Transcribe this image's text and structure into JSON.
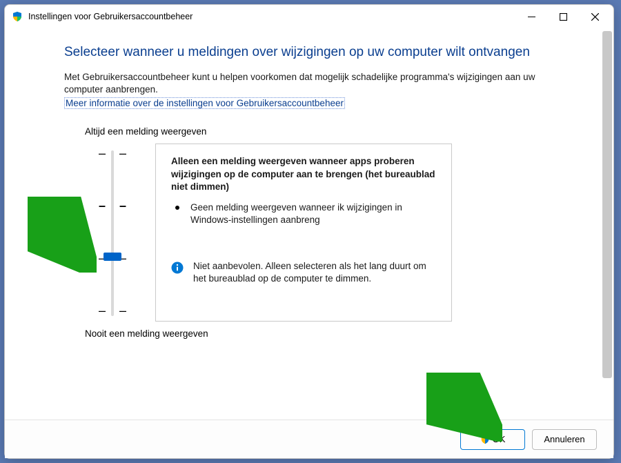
{
  "window": {
    "title": "Instellingen voor Gebruikersaccountbeheer"
  },
  "heading": "Selecteer wanneer u meldingen over wijzigingen op uw computer wilt ontvangen",
  "intro_line1": "Met Gebruikersaccountbeheer kunt u helpen voorkomen dat mogelijk schadelijke programma's wijzigingen aan uw computer aanbrengen.",
  "link_text": "Meer informatie over de instellingen voor Gebruikersaccountbeheer",
  "slider": {
    "top_label": "Altijd een melding weergeven",
    "bottom_label": "Nooit een melding weergeven"
  },
  "desc": {
    "title": "Alleen een melding weergeven wanneer apps proberen wijzigingen op de computer aan te brengen (het bureaublad niet dimmen)",
    "bullet": "Geen melding weergeven wanneer ik wijzigingen in Windows-instellingen aanbreng",
    "warning": "Niet aanbevolen. Alleen selecteren als het lang duurt om het bureaublad op de computer te dimmen."
  },
  "buttons": {
    "ok": "OK",
    "cancel": "Annuleren"
  }
}
